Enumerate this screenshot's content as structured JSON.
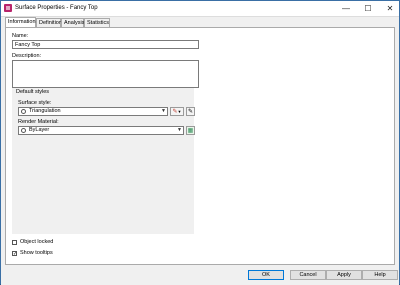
{
  "window": {
    "title": "Surface Properties - Fancy Top"
  },
  "titlebar": {
    "minimize": "—",
    "maximize": "☐",
    "close": "✕"
  },
  "tabs": [
    {
      "label": "Information"
    },
    {
      "label": "Definition"
    },
    {
      "label": "Analysis"
    },
    {
      "label": "Statistics"
    }
  ],
  "form": {
    "name_label": "Name:",
    "name_value": "Fancy Top",
    "description_label": "Description:",
    "description_value": ""
  },
  "default_styles": {
    "group_label": "Default styles",
    "surface_style_label": "Surface style:",
    "surface_style_value": "Triangulation",
    "render_material_label": "Render Material:",
    "render_material_value": "ByLayer"
  },
  "options": {
    "object_locked_label": "Object locked",
    "object_locked_checked": false,
    "show_tooltips_label": "Show tooltips",
    "show_tooltips_checked": true
  },
  "buttons": {
    "ok": "OK",
    "cancel": "Cancel",
    "apply": "Apply",
    "help": "Help"
  },
  "icons": {
    "app": "surface-properties-icon",
    "edit_style": "edit-style-icon",
    "style_detail": "style-detail-icon",
    "material_browse": "material-browse-icon"
  },
  "colors": {
    "accent": "#0078d7",
    "window_border": "#3a6fa5"
  }
}
